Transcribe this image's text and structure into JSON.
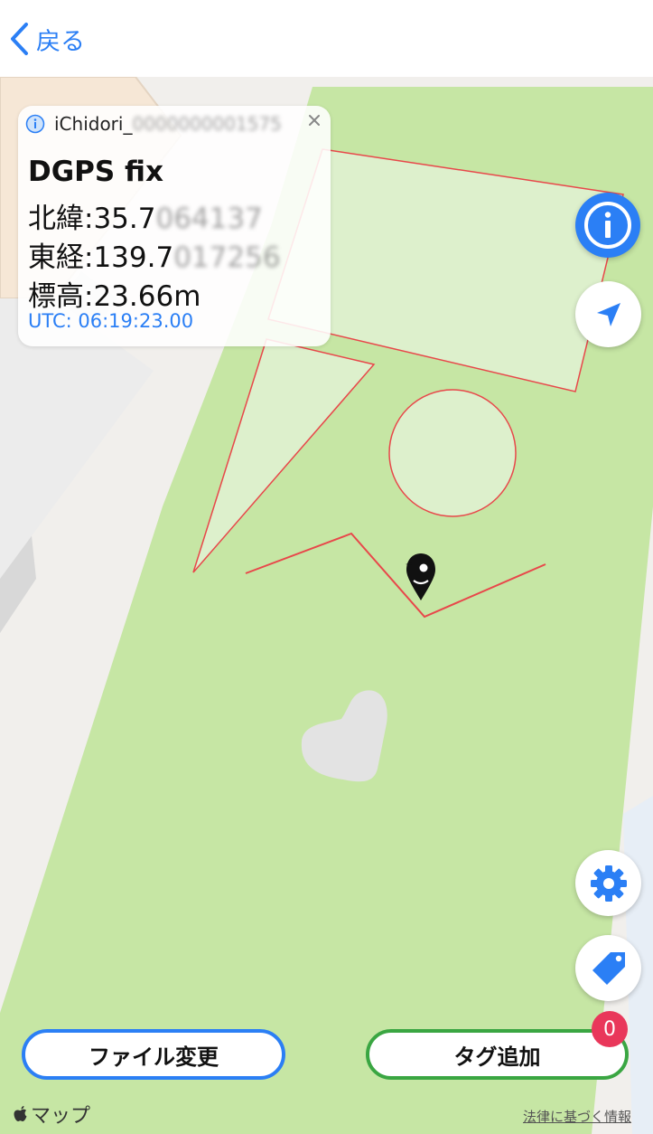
{
  "nav": {
    "back_label": "戻る"
  },
  "info_card": {
    "device_name": "iChidori_",
    "device_name_redacted": "0000000001575",
    "fix_status": "DGPS fix",
    "latitude_label": "北緯:",
    "latitude_visible": "35.7",
    "latitude_redacted": "064137",
    "longitude_label": "東経:",
    "longitude_visible": "139.7",
    "longitude_redacted": "017256",
    "altitude_label": "標高:",
    "altitude_value": "23.66m",
    "utc": "UTC: 06:19:23.00"
  },
  "buttons": {
    "file_change_label": "ファイル変更",
    "add_tag_label": "タグ追加",
    "tag_count": "0"
  },
  "footer": {
    "maps_brand": "マップ",
    "legal_link": "法律に基づく情報"
  },
  "colors": {
    "accent_blue": "#2b7ff5",
    "add_tag_green": "#3aa642",
    "park_green": "#c6e6a4",
    "shape_outline_red": "#e8474a",
    "badge_red": "#e9375a"
  },
  "icons": {
    "back": "chevron-left-icon",
    "info": "info-icon",
    "close": "close-icon",
    "location": "location-arrow-icon",
    "settings": "gear-icon",
    "tag": "tag-icon",
    "pin": "location-pin-icon",
    "brand": "apple-logo-icon"
  }
}
